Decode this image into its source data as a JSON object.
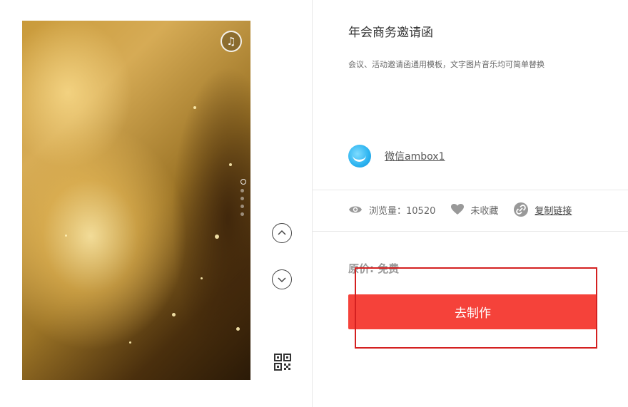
{
  "template": {
    "title": "年会商务邀请函",
    "description": "会议、活动邀请函通用模板，文字图片音乐均可简单替换"
  },
  "author": {
    "name": "微信ambox1",
    "avatar_icon": "avatar-icon"
  },
  "stats": {
    "views_label": "浏览量：10520",
    "favorite_label": "未收藏",
    "copy_link_label": "复制链接"
  },
  "price": {
    "label": "原价:",
    "value": "免费"
  },
  "actions": {
    "make_label": "去制作"
  },
  "preview": {
    "music_icon": "music-note-icon",
    "page_count": 5
  },
  "colors": {
    "accent": "#f5423a",
    "highlight_border": "#d42020"
  }
}
